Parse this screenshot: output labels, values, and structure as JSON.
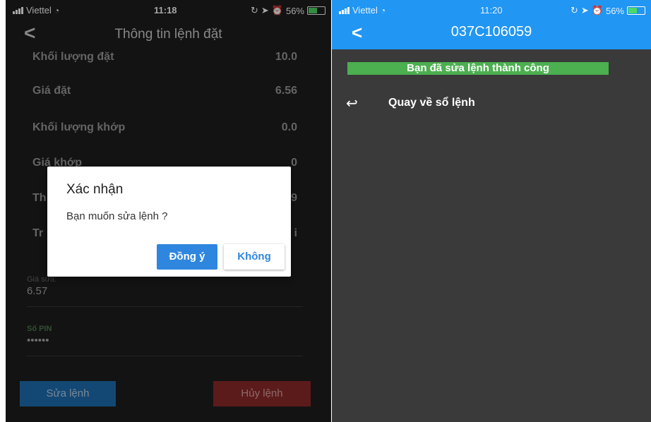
{
  "left": {
    "status_bar": {
      "carrier": "Viettel",
      "time": "11:18",
      "battery": "56%"
    },
    "header": {
      "title": "Thông tin lệnh đặt"
    },
    "rows": [
      {
        "label": "Khối lượng đặt",
        "value": "10.0"
      },
      {
        "label": "Giá đặt",
        "value": "6.56"
      },
      {
        "label": "Khối lượng khớp",
        "value": "0.0"
      },
      {
        "label": "Giá khớp",
        "value": "0"
      },
      {
        "label": "Th",
        "value": "9"
      },
      {
        "label": "Tr",
        "value": "i"
      }
    ],
    "price_field": {
      "label": "Giá sửa:",
      "value": "6.57"
    },
    "pin_field": {
      "label": "Số PIN",
      "value": "••••••"
    },
    "buttons": {
      "edit": "Sửa lệnh",
      "cancel": "Hủy lệnh"
    },
    "dialog": {
      "title": "Xác nhận",
      "message": "Bạn muốn sửa lệnh ?",
      "ok": "Đồng ý",
      "no": "Không"
    }
  },
  "right": {
    "status_bar": {
      "carrier": "Viettel",
      "time": "11:20",
      "battery": "56%"
    },
    "header": {
      "title": "037C106059"
    },
    "success_message": "Bạn đã sửa lệnh thành công",
    "back_link": "Quay về sổ lệnh"
  },
  "colors": {
    "accent_blue": "#2196f3",
    "success_green": "#4caf50",
    "danger_red": "#8e2a2a"
  }
}
